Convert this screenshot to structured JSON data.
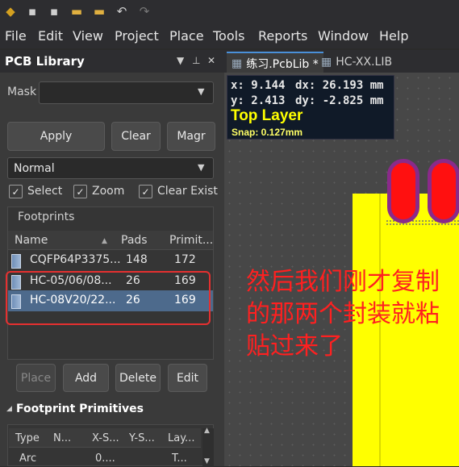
{
  "toolbar": {
    "icons": [
      "app-logo-icon",
      "save-icon",
      "save-all-icon",
      "open-icon",
      "open-project-icon",
      "undo-icon",
      "redo-icon"
    ]
  },
  "menu": [
    {
      "label": "File"
    },
    {
      "label": "Edit"
    },
    {
      "label": "View"
    },
    {
      "label": "Project"
    },
    {
      "label": "Place"
    },
    {
      "label": "Tools"
    },
    {
      "label": "Reports"
    },
    {
      "label": "Window"
    },
    {
      "label": "Help"
    }
  ],
  "panel": {
    "title": "PCB Library",
    "mask_label": "Mask",
    "mask_value": "",
    "apply": "Apply",
    "clear": "Clear",
    "magnify": "Magr",
    "mode": "Normal",
    "check_select": "Select",
    "check_zoom": "Zoom",
    "check_clear_existing": "Clear Exist",
    "footprints_title": "Footprints",
    "columns": [
      "Name",
      "Pads",
      "Primit..."
    ],
    "rows": [
      {
        "name": "CQFP64P3375...",
        "pads": "148",
        "prims": "172"
      },
      {
        "name": "HC-05/06/08...",
        "pads": "26",
        "prims": "169"
      },
      {
        "name": "HC-08V20/22...",
        "pads": "26",
        "prims": "169"
      }
    ],
    "place": "Place",
    "add": "Add",
    "delete": "Delete",
    "edit": "Edit",
    "prims_title": "Footprint Primitives",
    "prim_columns": [
      "Type",
      "N...",
      "X-S...",
      "Y-S...",
      "Lay..."
    ],
    "prim_rows": [
      {
        "type": "Arc",
        "n": "",
        "xs": "0....",
        "ys": "",
        "lay": "T..."
      }
    ]
  },
  "tabs": [
    {
      "label": "练习.PcbLib *"
    },
    {
      "label": "HC-XX.LIB"
    }
  ],
  "hud": {
    "x": "x:  9.144",
    "dx": "dx: 26.193 mm",
    "y": "y:  2.413",
    "dy": "dy: -2.825 mm",
    "layer": "Top Layer",
    "snap": "Snap: 0.127mm"
  },
  "annotation": "然后我们刚才复制的那两个封装就粘贴过来了",
  "colors": {
    "layer_fill": "#ffff00",
    "pad": "#ff1010",
    "pad_outline": "#8a2a8a",
    "annotation": "#ff2020",
    "highlight": "#e53030"
  }
}
